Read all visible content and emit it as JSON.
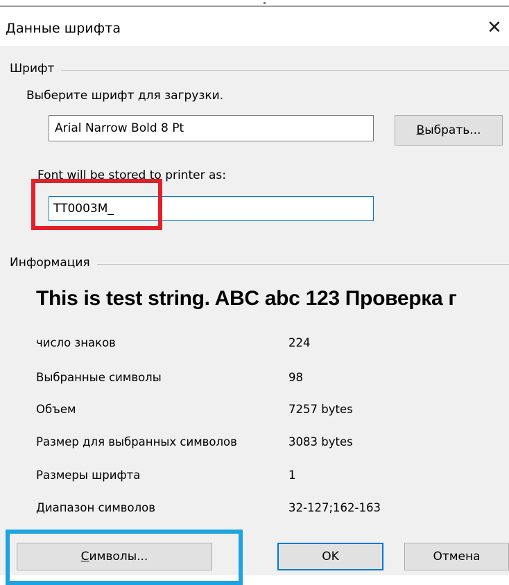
{
  "window": {
    "title": "Данные шрифта",
    "close_glyph": "✕"
  },
  "font_group": {
    "title": "Шрифт",
    "instruction": "Выберите шрифт для загрузки.",
    "selected_font": "Arial Narrow Bold 8 Pt",
    "select_button_label": "Выбрать...",
    "stored_as_label": "Font will be stored to printer as:",
    "stored_as_value": "TT0003M_"
  },
  "info_group": {
    "title": "Информация",
    "sample_text": "This is test string. ABC abc 123 Проверка г",
    "rows": [
      {
        "name": "число знаков",
        "value": "224"
      },
      {
        "name": "Выбранные символы",
        "value": "98"
      },
      {
        "name": "Объем",
        "value": "7257 bytes"
      },
      {
        "name": "Размер для выбранных символов",
        "value": "3083 bytes"
      },
      {
        "name": "Размеры шрифта",
        "value": "1"
      },
      {
        "name": "Диапазон символов",
        "value": "32-127;162-163"
      }
    ]
  },
  "buttons": {
    "symbols_label": "Символы...",
    "ok_label": "OK",
    "cancel_label": "Отмена"
  },
  "colors": {
    "highlight_red": "#e1202a",
    "highlight_blue": "#1da3e0",
    "focus_blue": "#0078d7",
    "dialog_bg": "#f0f0f0"
  }
}
